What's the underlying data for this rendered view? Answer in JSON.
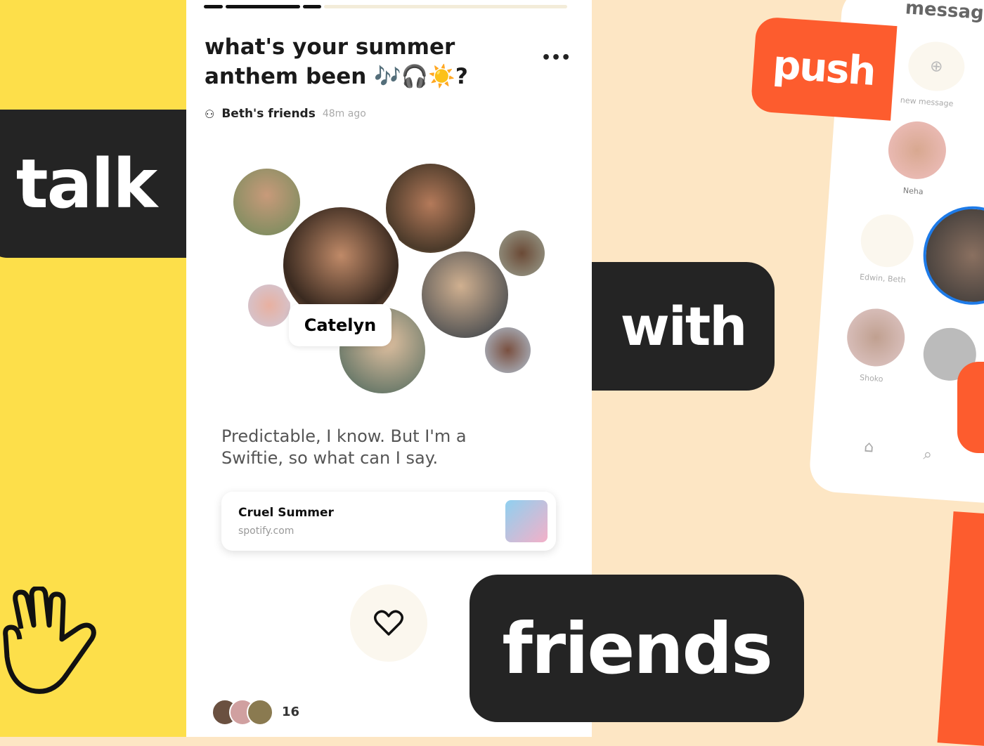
{
  "banners": {
    "talk": "talk",
    "with": "with",
    "friends": "friends",
    "push": "push"
  },
  "colors": {
    "yellow": "#fddf4a",
    "peach": "#fde6c4",
    "dark": "#242424",
    "orange": "#fd5c2e",
    "ring": "#1e7be8"
  },
  "post": {
    "title": "what's your summer anthem been 🎶🎧☀️?",
    "group": "Beth's friends",
    "time": "48m ago",
    "featured_name": "Catelyn",
    "reply": "Predictable, I know. But I'm a Swiftie, so what can I say.",
    "link": {
      "title": "Cruel Summer",
      "domain": "spotify.com"
    },
    "like_count": "16",
    "more_icon": "more-horizontal-icon"
  },
  "phone": {
    "header": "messages",
    "new_message": "new message",
    "contacts": [
      "Neha",
      "Edwin, Beth",
      "Shoko"
    ]
  }
}
